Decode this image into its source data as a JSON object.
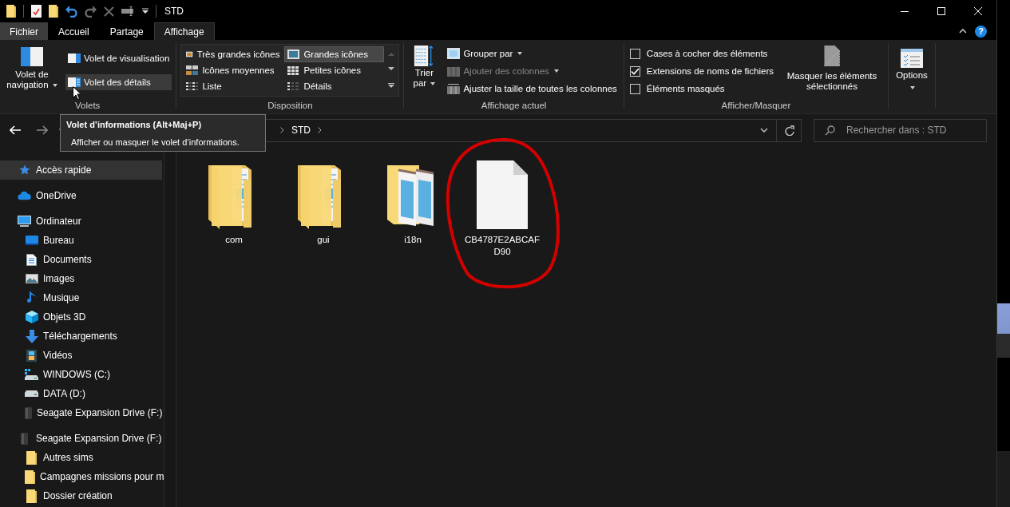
{
  "window": {
    "title": "STD"
  },
  "ribbon_tabs": [
    {
      "label": "Fichier",
      "kind": "file",
      "selected": false
    },
    {
      "label": "Accueil",
      "kind": "tab",
      "selected": false
    },
    {
      "label": "Partage",
      "kind": "tab",
      "selected": false
    },
    {
      "label": "Affichage",
      "kind": "tab",
      "selected": true
    }
  ],
  "help_button": "?",
  "panes": {
    "label": "Volets",
    "navigation_button": "Volet de navigation",
    "buttons": [
      {
        "label": "Volet de visualisation",
        "hovered": false
      },
      {
        "label": "Volet des détails",
        "hovered": true
      }
    ]
  },
  "layout": {
    "label": "Disposition",
    "options": [
      {
        "label": "Très grandes icônes",
        "selected": false
      },
      {
        "label": "Grandes icônes",
        "selected": true
      },
      {
        "label": "Icônes moyennes",
        "selected": false
      },
      {
        "label": "Petites icônes",
        "selected": false
      },
      {
        "label": "Liste",
        "selected": false
      },
      {
        "label": "Détails",
        "selected": false
      }
    ]
  },
  "current_view": {
    "label": "Affichage actuel",
    "sort_button": "Trier par",
    "commands": [
      {
        "label": "Grouper par",
        "disabled": false,
        "menu": true
      },
      {
        "label": "Ajouter des colonnes",
        "disabled": true,
        "menu": true
      },
      {
        "label": "Ajuster la taille de toutes les colonnes",
        "disabled": false,
        "menu": false
      }
    ]
  },
  "show_hide": {
    "label": "Afficher/Masquer",
    "checkboxes": [
      {
        "label": "Cases à cocher des éléments",
        "checked": false
      },
      {
        "label": "Extensions de noms de fichiers",
        "checked": true
      },
      {
        "label": "Éléments masqués",
        "checked": false
      }
    ],
    "hide_selected_button": "Masquer les éléments sélectionnés"
  },
  "options_button": "Options",
  "address_bar": {
    "path": [
      "STD"
    ]
  },
  "search": {
    "placeholder": "Rechercher dans : STD"
  },
  "tooltip": {
    "title": "Volet d’informations (Alt+Maj+P)",
    "text": "Afficher ou masquer le volet d’informations."
  },
  "navigation": [
    {
      "label": "Accès rapide",
      "kind": "star",
      "selected": true
    },
    {
      "label": "OneDrive",
      "kind": "cloud",
      "selected": false
    },
    {
      "label": "Ordinateur",
      "kind": "computer",
      "selected": false,
      "children": [
        {
          "label": "Bureau",
          "kind": "desktop",
          "selected": false
        },
        {
          "label": "Documents",
          "kind": "document",
          "selected": false
        },
        {
          "label": "Images",
          "kind": "image",
          "selected": false
        },
        {
          "label": "Musique",
          "kind": "music",
          "selected": false
        },
        {
          "label": "Objets 3D",
          "kind": "cube",
          "selected": false
        },
        {
          "label": "Téléchargements",
          "kind": "download",
          "selected": false
        },
        {
          "label": "Vidéos",
          "kind": "video",
          "selected": false
        },
        {
          "label": "WINDOWS (C:)",
          "kind": "system-drive",
          "selected": false
        },
        {
          "label": "DATA (D:)",
          "kind": "drive",
          "selected": false
        },
        {
          "label": "Seagate Expansion Drive (F:)",
          "kind": "external-drive",
          "selected": false
        }
      ]
    },
    {
      "label": "Seagate Expansion Drive (F:)",
      "kind": "external-drive",
      "selected": false,
      "children": [
        {
          "label": "Autres sims",
          "kind": "folder",
          "selected": false
        },
        {
          "label": "Campagnes missions pour m",
          "kind": "folder",
          "selected": false
        },
        {
          "label": "Dossier création",
          "kind": "folder",
          "selected": false
        }
      ]
    }
  ],
  "files": [
    {
      "name": "com",
      "kind": "folder-documents",
      "circled": false
    },
    {
      "name": "gui",
      "kind": "folder-documents",
      "circled": false
    },
    {
      "name": "i18n",
      "kind": "folder-notepad",
      "circled": false
    },
    {
      "name": "CB4787E2ABCAFD90",
      "kind": "file",
      "circled": true
    }
  ]
}
